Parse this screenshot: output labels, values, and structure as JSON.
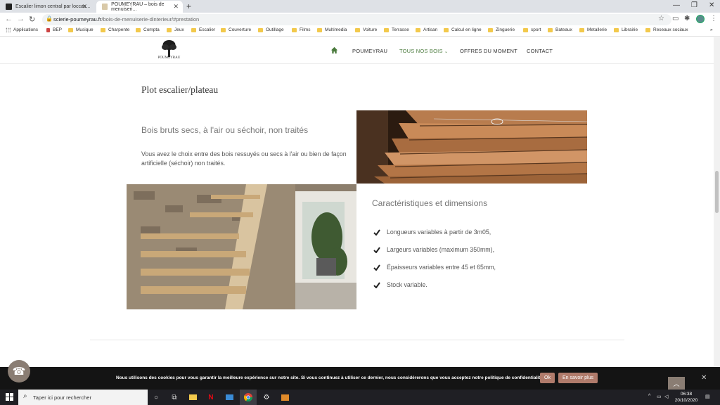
{
  "browser": {
    "tabs": [
      {
        "title": "Escalier limon central par loccas..."
      },
      {
        "title": "POUMEYRAU – bois de menuiseri..."
      }
    ],
    "url_domain": "scierie-poumeyrau.fr",
    "url_path": "/bois-de-menuiserie-dinterieur/#prestation",
    "bookmarks": [
      "Applications",
      "BEP",
      "Musique",
      "Charpente",
      "Compta",
      "Jeux",
      "Escalier",
      "Couverture",
      "Outillage",
      "Films",
      "Multimedia",
      "Voiture",
      "Terrasse",
      "Artisan",
      "Calcul en ligne",
      "Zinguerie",
      "sport",
      "Bateaux",
      "Metallerie",
      "Librairie",
      "Reseaux sociaux"
    ]
  },
  "site": {
    "logo_text": "POUMEYRAU",
    "nav": {
      "poumeyrau": "POUMEYRAU",
      "tous_nos_bois": "TOUS NOS BOIS",
      "offres": "OFFRES DU MOMENT",
      "contact": "CONTACT"
    },
    "title": "Plot escalier/plateau",
    "subtitle1": "Bois bruts secs, à l'air ou séchoir, non traités",
    "paragraph": "Vous avez le choix entre des bois ressuyés ou secs à l'air ou bien de façon artificielle (séchoir) non traités.",
    "subtitle2": "Caractéristiques et dimensions",
    "features": [
      "Longueurs variables à partir de 3m05,",
      "Largeurs variables (maximum 350mm),",
      "Épaisseurs variables entre 45 et 65mm,",
      "Stock variable."
    ]
  },
  "cookie": {
    "text": "Nous utilisons des cookies pour vous garantir la meilleure expérience sur notre site. Si vous continuez à utiliser ce dernier, nous considérerons que vous acceptez notre politique de confidentialité.",
    "ok": "Ok",
    "more": "En savoir plus"
  },
  "taskbar": {
    "search_placeholder": "Taper ici pour rechercher",
    "time": "06:38",
    "date": "20/10/2020"
  },
  "colors": {
    "accent_green": "#4a7a3c",
    "cookie_button": "#b07b6b",
    "brown_button": "#8a7d73"
  }
}
